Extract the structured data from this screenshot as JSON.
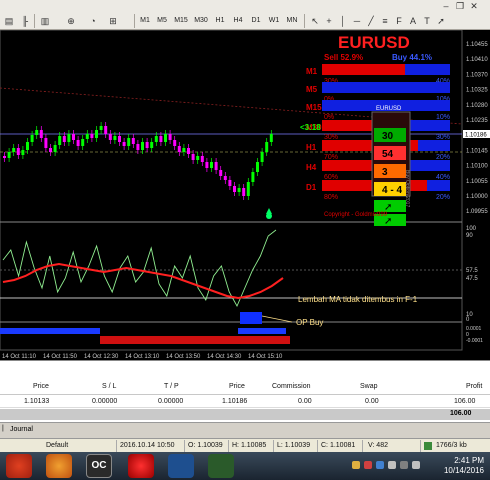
{
  "toolbar": {
    "timeframes": [
      "M1",
      "M5",
      "M15",
      "M30",
      "H1",
      "H4",
      "D1",
      "W1",
      "MN"
    ],
    "icons": [
      "new-chart-icon",
      "profiles-icon",
      "chart-bars-icon",
      "zoom-in-icon",
      "zoom-out-icon",
      "auto-scroll-icon",
      "periods-icon",
      "templates-icon",
      "cursor-icon",
      "crosshair-icon",
      "vertical-line-icon",
      "horizontal-line-icon",
      "trendline-icon",
      "fibo-icon",
      "text-icon",
      "arrows-icon"
    ]
  },
  "chart": {
    "symbol_title": "EURUSD",
    "sell_label": "Sell 52.9%",
    "buy_label": "Buy 44.1%",
    "tf_rows": [
      {
        "tf": "M1",
        "left": "30%",
        "right": "40%",
        "sell_pct": 0.65,
        "buy_pct": 0.35
      },
      {
        "tf": "M5",
        "left": "0%",
        "right": "10%",
        "sell_pct": 0.0,
        "buy_pct": 1.0
      },
      {
        "tf": "M15",
        "left": "0%",
        "right": "10%",
        "sell_pct": 0.0,
        "buy_pct": 1.0
      },
      {
        "tf": "M30",
        "left": "30%",
        "right": "30%",
        "sell_pct": 0.55,
        "buy_pct": 0.45
      },
      {
        "tf": "H1",
        "left": "70%",
        "right": "20%",
        "sell_pct": 0.75,
        "buy_pct": 0.25
      },
      {
        "tf": "H4",
        "left": "60%",
        "right": "40%",
        "sell_pct": 0.6,
        "buy_pct": 0.4
      },
      {
        "tf": "D1",
        "left": "80%",
        "right": "20%",
        "sell_pct": 0.82,
        "buy_pct": 0.18
      }
    ],
    "timer": "<3:18",
    "info_box": {
      "title": "EURUSD",
      "cells": [
        "30",
        "54",
        "3",
        "4 - 4"
      ],
      "side": "Buy Option 2017"
    },
    "copyright": "Copyright - Goldmix999",
    "annotation_1": "Lembah MA tidak ditembus in F-1",
    "annotation_2": "OP Buy",
    "price_axis": [
      "1.10455",
      "1.10410",
      "1.10370",
      "1.10325",
      "1.10280",
      "1.10235",
      "1.10186",
      "1.10145",
      "1.10100",
      "1.10055",
      "1.10000",
      "1.09955"
    ],
    "current_price": "1.10186",
    "osc_axis": [
      "100",
      "90",
      "57.5",
      "47.5",
      "10",
      "0"
    ],
    "hist_axis": [
      "0.0001",
      "0",
      "-0.0001"
    ],
    "time_axis": [
      "14 Oct 11:10",
      "14 Oct 11:50",
      "14 Oct 12:30",
      "14 Oct 13:10",
      "14 Oct 13:50",
      "14 Oct 14:30",
      "14 Oct 15:10"
    ],
    "colors": {
      "bull": "#00ff00",
      "bear": "#ff00ff",
      "ma": "#ff2020",
      "osc": "#90ee90",
      "sell": "#e00000",
      "buy": "#1020e0",
      "title": "#ff2020"
    }
  },
  "terminal": {
    "headers": {
      "price": "Price",
      "sl": "S / L",
      "tp": "T / P",
      "price2": "Price",
      "commission": "Commission",
      "swap": "Swap",
      "profit": "Profit"
    },
    "row": {
      "price": "1.10133",
      "sl": "0.00000",
      "tp": "0.00000",
      "price2": "1.10186",
      "commission": "0.00",
      "swap": "0.00",
      "profit": "106.00"
    },
    "total": "106.00",
    "tab": "Journal"
  },
  "status": {
    "profile": "Default",
    "datetime": "2016.10.14 10:50",
    "open": "O: 1.10039",
    "high": "H: 1.10085",
    "low": "L: 1.10039",
    "close": "C: 1.10081",
    "volume": "V: 482",
    "traffic": "1766/3 kb"
  },
  "taskbar": {
    "time": "2:41 PM",
    "date": "10/14/2016"
  }
}
